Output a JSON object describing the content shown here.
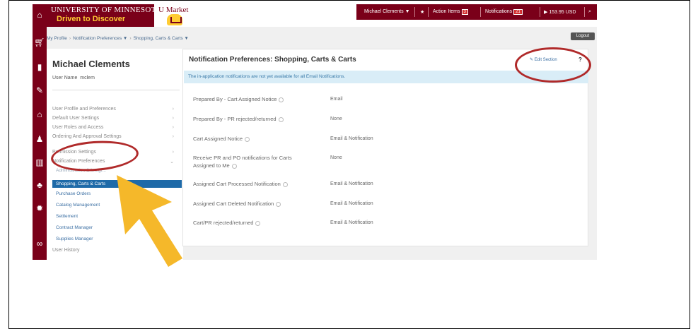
{
  "header": {
    "university": "UNIVERSITY OF MINNESOTA",
    "tagline": "Driven to Discover",
    "app_name": "U Market",
    "user_menu": "Michael Clements ▼",
    "action_items_label": "Action Items",
    "action_items_count": "3",
    "notifications_label": "Notifications",
    "notifications_count": "21",
    "cart_total": "153.95 USD"
  },
  "breadcrumb": {
    "items": [
      "My Profile",
      "Notification Preferences ▼",
      "Shopping, Carts & Carts ▼"
    ]
  },
  "logout_label": "Logout",
  "sidebar": {
    "name": "Michael Clements",
    "user_name_label": "User Name",
    "user_name_value": "mclem",
    "menu": [
      "User Profile and Preferences",
      "Default User Settings",
      "User Roles and Access",
      "Ordering And Approval Settings",
      "Permission Settings",
      "Notification Preferences"
    ],
    "partial_item": "Administration & Integr...",
    "active_sub": "Shopping, Carts & Carts",
    "sub_items": [
      "Purchase Orders",
      "Catalog Management",
      "Settlement",
      "Contract Manager",
      "Supplies Manager"
    ],
    "user_history": "User History"
  },
  "main": {
    "title": "Notification Preferences: Shopping, Carts & Carts",
    "edit_label": "Edit Section",
    "help_label": "?",
    "info_banner": "The in-application notifications are not yet available for all Email Notifications.",
    "rows": [
      {
        "label": "Prepared By - Cart Assigned Notice",
        "value": "Email"
      },
      {
        "label": "Prepared By - PR rejected/returned",
        "value": "None"
      },
      {
        "label": "Cart Assigned Notice",
        "value": "Email & Notification"
      },
      {
        "label": "Receive PR and PO notifications for Carts Assigned to Me",
        "value": "None"
      },
      {
        "label": "Assigned Cart Processed Notification",
        "value": "Email & Notification"
      },
      {
        "label": "Assigned Cart Deleted Notification",
        "value": "Email & Notification"
      },
      {
        "label": "Cart/PR rejected/returned",
        "value": "Email & Notification"
      }
    ]
  },
  "colors": {
    "brand_maroon": "#7a0019",
    "brand_gold": "#ffcc33",
    "active_blue": "#1e6aa8",
    "annotation_red": "#b02a2a",
    "annotation_arrow": "#f5b82a"
  }
}
